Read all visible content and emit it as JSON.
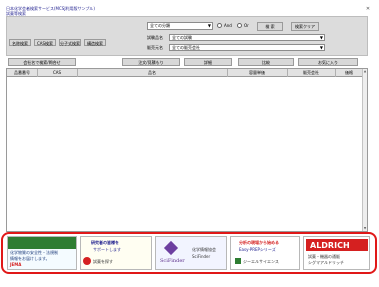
{
  "app": {
    "title_line1": "日本化学会者検索サービス(MCSJ利用版サンプル)",
    "title_line2": "試薬等検索",
    "close_glyph": "✕"
  },
  "search": {
    "category_value": "全ての分類",
    "radio_a_label": "And",
    "radio_b_label": "Or",
    "search_button": "検 索",
    "clear_button": "検索クリア",
    "row2_label": "試験品名",
    "row2_value": "全ての試験",
    "row3_label": "販売元名",
    "row3_value": "全ての販売会社",
    "filter_tabs": [
      "名称検索",
      "CAS検索",
      "分子式検索",
      "構造検索"
    ]
  },
  "toolbar": {
    "buttons": [
      "会社名で検索/問合せ",
      "注文/見積もり",
      "詳細",
      "比較",
      "お気に入り"
    ]
  },
  "table": {
    "columns": [
      "品番番号",
      "CAS",
      "品名",
      "容量単価",
      "販売会社",
      "価格"
    ]
  },
  "banners": [
    {
      "line1": "化学物質の安全性・法規制",
      "line2": "情報をお届けします。",
      "line3": "JEMA"
    },
    {
      "line1": "研究者の皆様を",
      "line2": "サポートします",
      "line3": "試薬を探す"
    },
    {
      "logo": "SciFinder",
      "line1": "化学情報協会",
      "line2": "SciFinder"
    },
    {
      "line1": "分析の現場から始める",
      "line2": "Easy-PREPシリーズ",
      "line3": "ジーエルサイエンス"
    },
    {
      "logo": "ALDRICH",
      "line1": "試薬・機器の通販",
      "line2": "シグマアルドリッチ"
    }
  ],
  "colors": {
    "page_bg": "#ffffff",
    "panel_bg": "#dcdcdc",
    "header_bg": "#e2e2e2",
    "title_blue": "#1a1a8c",
    "highlight_red": "#e01818",
    "aldrich_red": "#d52020"
  }
}
